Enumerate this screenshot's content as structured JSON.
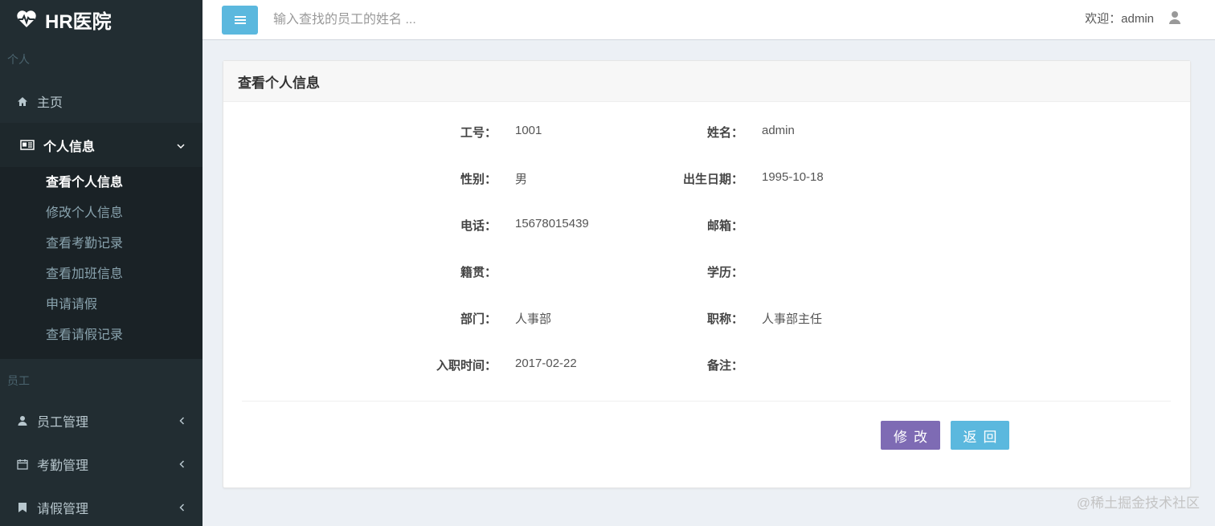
{
  "app": {
    "logo_text": "HR医院"
  },
  "sidebar": {
    "section_personal": "个人",
    "home": "主页",
    "personal_info": "个人信息",
    "sub_items": [
      "查看个人信息",
      "修改个人信息",
      "查看考勤记录",
      "查看加班信息",
      "申请请假",
      "查看请假记录"
    ],
    "section_staff": "员工",
    "staff_mgmt": "员工管理",
    "attendance_mgmt": "考勤管理",
    "leave_mgmt": "请假管理"
  },
  "header": {
    "search_placeholder": "输入查找的员工的姓名 ...",
    "welcome": "欢迎：admin"
  },
  "box": {
    "title": "查看个人信息",
    "fields": {
      "emp_no_label": "工号：",
      "emp_no": "1001",
      "name_label": "姓名：",
      "name": "admin",
      "gender_label": "性别：",
      "gender": "男",
      "birth_label": "出生日期：",
      "birth": "1995-10-18",
      "phone_label": "电话：",
      "phone": "15678015439",
      "email_label": "邮箱：",
      "email": "",
      "native_label": "籍贯：",
      "native": "",
      "education_label": "学历：",
      "education": "",
      "dept_label": "部门：",
      "dept": "人事部",
      "title_label": "职称：",
      "title": "人事部主任",
      "hire_label": "入职时间：",
      "hire": "2017-02-22",
      "remark_label": "备注：",
      "remark": ""
    },
    "edit_button": "修改",
    "back_button": "返回"
  },
  "watermark": "@稀土掘金技术社区",
  "colors": {
    "sidebar_bg": "#222d32",
    "submenu_bg": "#1a2226",
    "accent_blue": "#5bb8de",
    "edit_purple": "#7e6bb4"
  }
}
